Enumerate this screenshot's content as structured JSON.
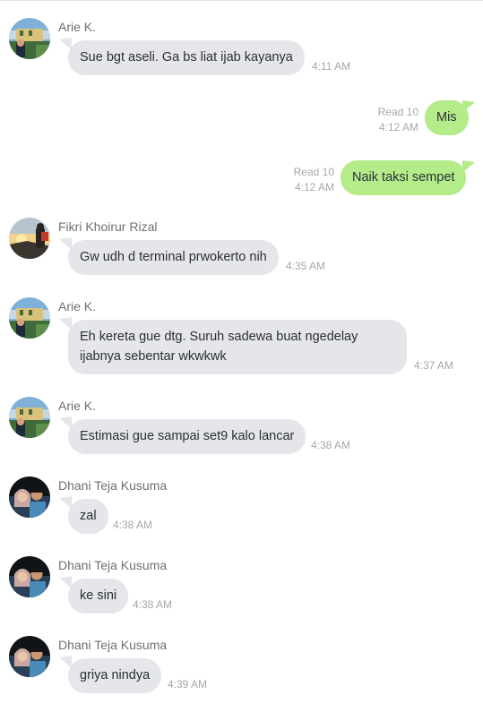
{
  "messages": [
    {
      "sender": "Arie K.",
      "text": "Sue bgt aseli. Ga bs liat ijab kayanya",
      "time": "4:11 AM"
    },
    {
      "read": "Read 10",
      "text": "Mis",
      "time": "4:12 AM"
    },
    {
      "read": "Read 10",
      "text": "Naik taksi sempet",
      "time": "4:12 AM"
    },
    {
      "sender": "Fikri Khoirur Rizal",
      "text": "Gw udh d terminal prwokerto nih",
      "time": "4:35 AM"
    },
    {
      "sender": "Arie K.",
      "line1": "Eh kereta gue dtg. Suruh sadewa buat ngedelay",
      "line2": "ijabnya sebentar wkwkwk",
      "time": "4:37 AM"
    },
    {
      "sender": "Arie K.",
      "text": "Estimasi gue sampai set9 kalo lancar",
      "time": "4:38 AM"
    },
    {
      "sender": "Dhani Teja Kusuma",
      "text": "zal",
      "time": "4:38 AM"
    },
    {
      "sender": "Dhani Teja Kusuma",
      "text": "ke sini",
      "time": "4:38 AM"
    },
    {
      "sender": "Dhani Teja Kusuma",
      "text": "griya nindya",
      "time": "4:39 AM"
    }
  ],
  "colors": {
    "incoming_bubble": "#e5e6ea",
    "outgoing_bubble": "#b5ec8a",
    "timestamp": "#a3a8ad",
    "sender_name": "#6b7075"
  }
}
